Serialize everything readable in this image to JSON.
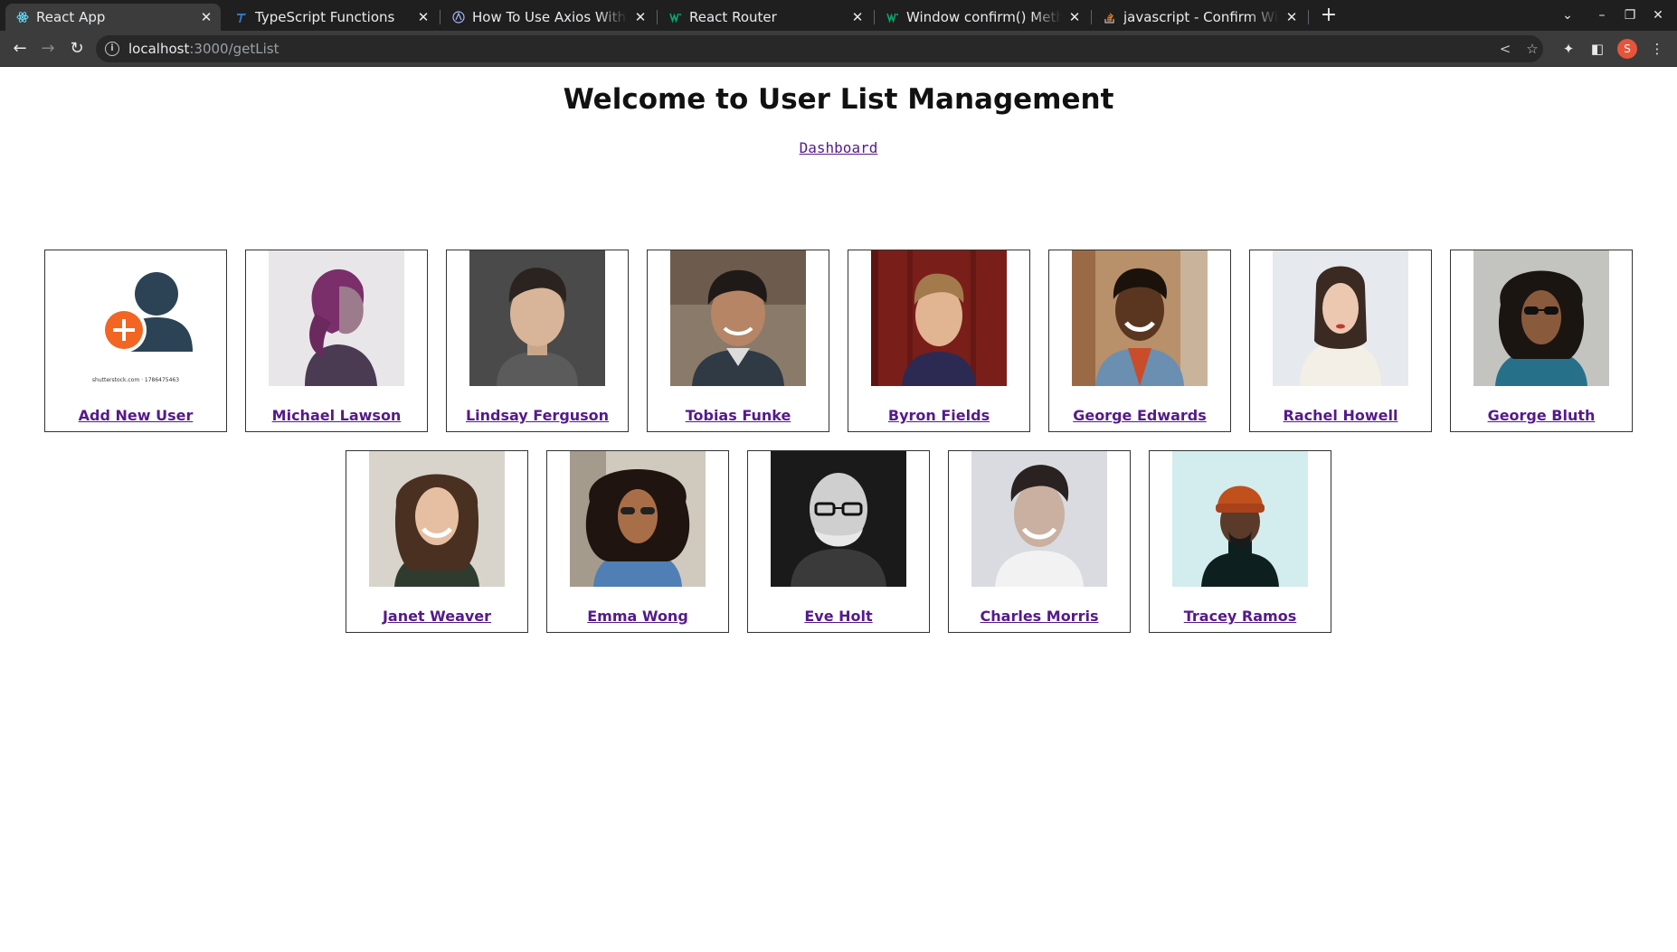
{
  "browser": {
    "tabs": [
      {
        "title": "React App",
        "active": true
      },
      {
        "title": "TypeScript Functions",
        "active": false
      },
      {
        "title": "How To Use Axios With React",
        "active": false
      },
      {
        "title": "React Router",
        "active": false
      },
      {
        "title": "Window confirm() Method",
        "active": false
      },
      {
        "title": "javascript - Confirm Window",
        "active": false
      }
    ],
    "url_host": "localhost",
    "url_path": ":3000/getList",
    "profile_initial": "S"
  },
  "page": {
    "heading": "Welcome to User List Management",
    "dashboard_link": "Dashboard",
    "add_user_label": "Add New User",
    "add_user_caption": "shutterstock.com · 1786475463",
    "users_row1": [
      "Michael Lawson",
      "Lindsay Ferguson",
      "Tobias Funke",
      "Byron Fields",
      "George Edwards",
      "Rachel Howell",
      "George Bluth"
    ],
    "users_row2": [
      "Janet Weaver",
      "Emma Wong",
      "Eve Holt",
      "Charles Morris",
      "Tracey Ramos"
    ]
  },
  "colors": {
    "tabbar_bg": "#1f1f1f",
    "toolbar_bg": "#3c3c3c",
    "link_visited": "#551a8b",
    "add_icon_person": "#2c4356",
    "add_icon_plus": "#f26522"
  }
}
